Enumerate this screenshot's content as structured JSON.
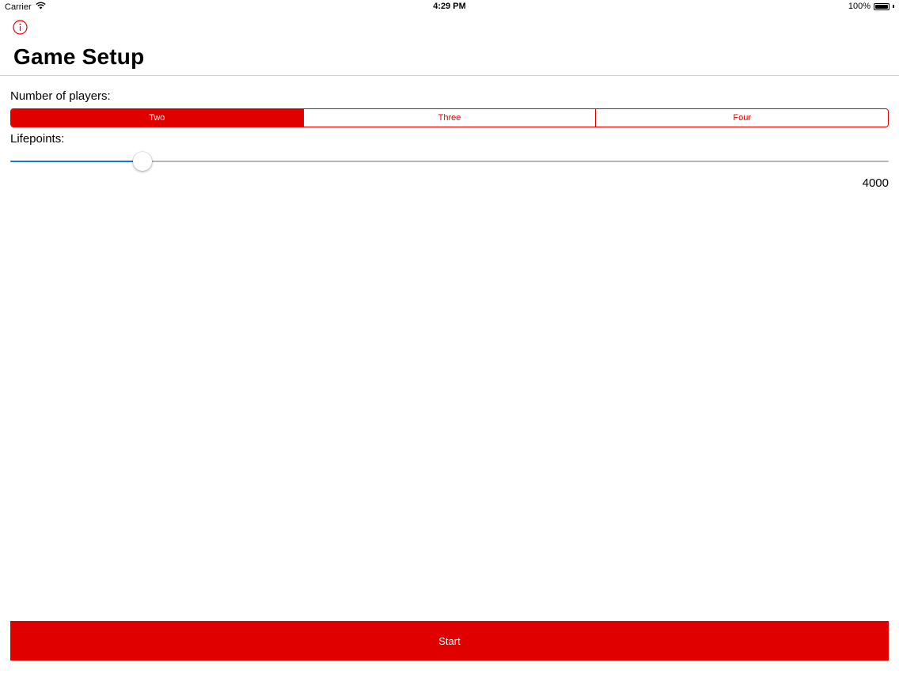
{
  "status_bar": {
    "carrier": "Carrier",
    "time": "4:29 PM",
    "battery": "100%",
    "icons": [
      "wifi-icon",
      "battery-icon"
    ]
  },
  "nav": {
    "info_icon": "info-icon",
    "title": "Game Setup"
  },
  "players": {
    "label": "Number of players:",
    "options": [
      "Two",
      "Three",
      "Four"
    ],
    "selected_index": 0
  },
  "lifepoints": {
    "label": "Lifepoints:",
    "value": "4000",
    "slider_level": 0.15
  },
  "start_button": {
    "label": "Start"
  },
  "colors": {
    "accent": "#e00000",
    "slider_fill": "#1a73e0",
    "slider_track": "#b6b6b6"
  }
}
